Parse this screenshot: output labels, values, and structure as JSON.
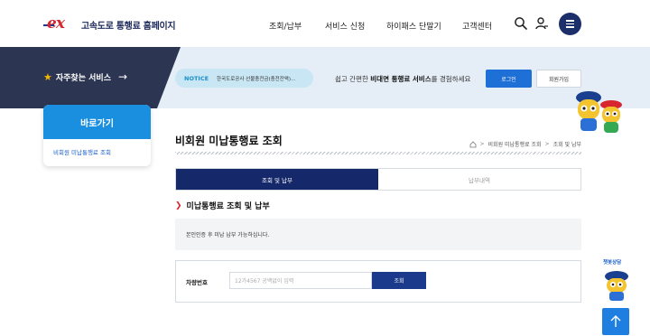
{
  "header": {
    "logo_text": "고속도로 통행료 홈페이지",
    "nav": [
      "조회/납부",
      "서비스 신청",
      "하이패스 단말기",
      "고객센터"
    ]
  },
  "band": {
    "favorites_label": "자주찾는 서비스",
    "notice_tag": "NOTICE",
    "notice_text": "한국도로공사 선불충전금(충전잔액)...",
    "promo_pre": "쉽고 간편한 ",
    "promo_bold": "비대면 통행료 서비스",
    "promo_post": "를 경험하세요",
    "login_label": "로그인",
    "join_label": "회원가입"
  },
  "side": {
    "title": "바로가기",
    "item": "비회원 미납통행료 조회"
  },
  "main": {
    "page_title": "비회원 미납통행료 조회",
    "breadcrumbs": [
      "비회원 미납통행료 조회",
      "조회 및 납부"
    ],
    "tabs": [
      "조회 및 납부",
      "납부내역"
    ],
    "section_title": "미납통행료 조회 및 납부",
    "info_text": "본인인증 후 미납 납부 가능하십니다.",
    "form_label": "차량번호",
    "input_placeholder": "12가4567 공백없이 입력",
    "search_label": "조회"
  },
  "floating": {
    "chat_label": "챗봇상담"
  },
  "colors": {
    "brand_red": "#d7262e",
    "navy": "#14286a",
    "blue": "#1e6fd6",
    "sky": "#1a8fe0"
  }
}
